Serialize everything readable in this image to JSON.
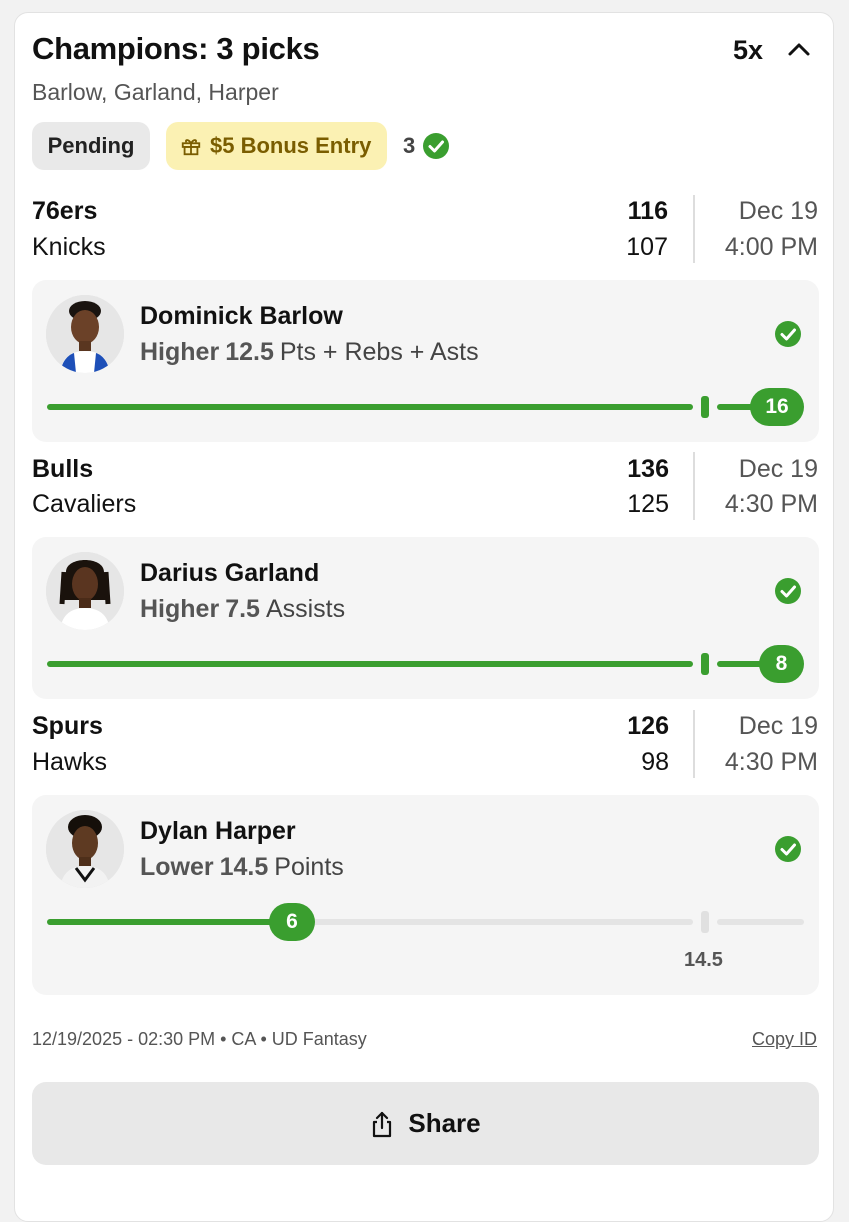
{
  "entry": {
    "title": "Champions: 3 picks",
    "multiplier": "5x",
    "players_summary": "Barlow, Garland, Harper",
    "status": "Pending",
    "bonus": "$5 Bonus Entry",
    "correct_count": "3"
  },
  "games": [
    {
      "team1": "76ers",
      "score1": "116",
      "team2": "Knicks",
      "score2": "107",
      "date": "Dec 19",
      "time": "4:00 PM"
    },
    {
      "team1": "Bulls",
      "score1": "136",
      "team2": "Cavaliers",
      "score2": "125",
      "date": "Dec 19",
      "time": "4:30 PM"
    },
    {
      "team1": "Spurs",
      "score1": "126",
      "team2": "Hawks",
      "score2": "98",
      "date": "Dec 19",
      "time": "4:30 PM"
    }
  ],
  "picks": [
    {
      "player": "Dominick Barlow",
      "direction": "Higher",
      "line": "12.5",
      "stat": "Pts + Rebs + Asts",
      "actual": "16",
      "progress": 1.0
    },
    {
      "player": "Darius Garland",
      "direction": "Higher",
      "line": "7.5",
      "stat": "Assists",
      "actual": "8",
      "progress": 1.0
    },
    {
      "player": "Dylan Harper",
      "direction": "Lower",
      "line": "14.5",
      "stat": "Points",
      "actual": "6",
      "progress": 0.41
    }
  ],
  "footer": {
    "meta": "12/19/2025 - 02:30 PM • CA • UD Fantasy",
    "copy_id": "Copy ID",
    "share": "Share"
  },
  "colors": {
    "accent": "#3a9e2f",
    "bonus_bg": "#fbf1b3",
    "bonus_text": "#7a5d00"
  },
  "icons": [
    "chevron-up-icon",
    "gift-icon",
    "check-circle-icon",
    "share-icon"
  ]
}
